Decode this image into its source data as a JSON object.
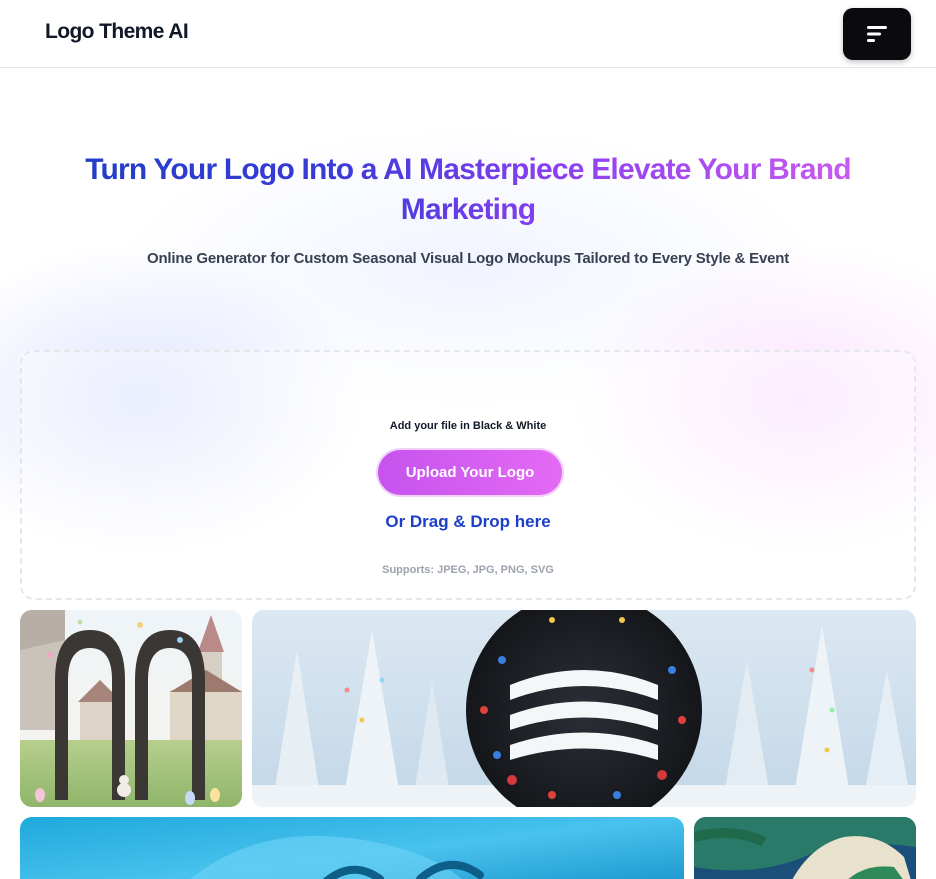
{
  "header": {
    "brand": "Logo Theme AI",
    "menu_icon": "menu-lines-icon"
  },
  "hero": {
    "title": "Turn Your Logo Into a AI Masterpiece Elevate Your Brand Marketing",
    "subtitle": "Online Generator for Custom Seasonal Visual Logo Mockups Tailored to Every Style & Event"
  },
  "upload": {
    "hint": "Add your file in Black & White",
    "button_label": "Upload Your Logo",
    "drag_text": "Or Drag & Drop here",
    "supports": "Supports: JPEG, JPG, PNG, SVG"
  },
  "gallery": [
    {
      "theme": "easter-church-arch"
    },
    {
      "theme": "winter-forest-christmas"
    },
    {
      "theme": "water-ocean"
    },
    {
      "theme": "tropical-island"
    }
  ],
  "colors": {
    "title_gradient_start": "#1e3fc4",
    "title_gradient_end": "#d15ef0",
    "upload_button": "#d463f1",
    "drag_text": "#1d3fc7",
    "menu_button": "#0b0b0f"
  }
}
